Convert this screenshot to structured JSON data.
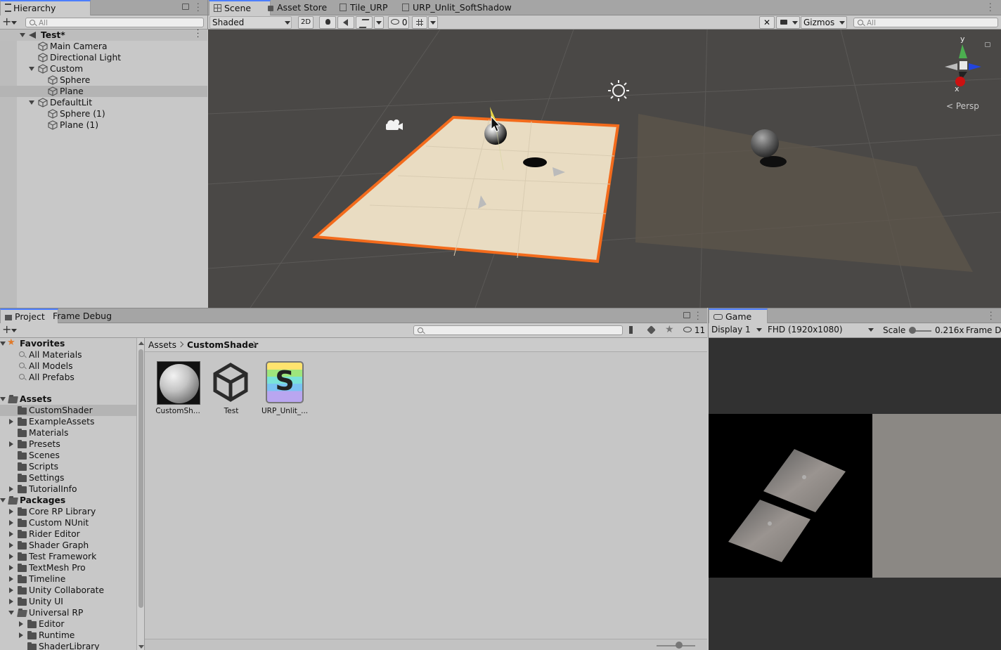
{
  "hierarchy": {
    "tab": "Hierarchy",
    "search_placeholder": "All",
    "scene_name": "Test*",
    "items": [
      {
        "label": "Main Camera"
      },
      {
        "label": "Directional Light"
      },
      {
        "label": "Custom"
      },
      {
        "label": "Sphere"
      },
      {
        "label": "Plane"
      },
      {
        "label": "DefaultLit"
      },
      {
        "label": "Sphere (1)"
      },
      {
        "label": "Plane (1)"
      }
    ]
  },
  "scene_tabs": [
    "Scene",
    "Asset Store",
    "Tile_URP",
    "URP_Unlit_SoftShadow"
  ],
  "scene_toolbar": {
    "shading_mode": "Shaded",
    "mode_2d": "2D",
    "hidden_count": "0",
    "gizmos": "Gizmos",
    "search_placeholder": "All",
    "persp": "Persp",
    "axis_y": "y",
    "axis_x": "x"
  },
  "project": {
    "tabs": [
      "Project",
      "Frame Debug"
    ],
    "hidden_count": "11",
    "favorites_label": "Favorites",
    "favorites": [
      "All Materials",
      "All Models",
      "All Prefabs"
    ],
    "assets_label": "Assets",
    "assets": [
      "CustomShader",
      "ExampleAssets",
      "Materials",
      "Presets",
      "Scenes",
      "Scripts",
      "Settings",
      "TutorialInfo"
    ],
    "packages_label": "Packages",
    "packages": [
      "Core RP Library",
      "Custom NUnit",
      "Rider Editor",
      "Shader Graph",
      "Test Framework",
      "TextMesh Pro",
      "Timeline",
      "Unity Collaborate",
      "Unity UI",
      "Universal RP"
    ],
    "universal_children": [
      "Editor",
      "Runtime",
      "ShaderLibrary"
    ],
    "breadcrumb": [
      "Assets",
      "CustomShader"
    ],
    "files": [
      {
        "label": "CustomSh..."
      },
      {
        "label": "Test"
      },
      {
        "label": "URP_Unlit_..."
      }
    ],
    "shader_letter": "S"
  },
  "game": {
    "tab": "Game",
    "display": "Display 1",
    "resolution": "FHD (1920x1080)",
    "scale_label": "Scale",
    "scale_value": "0.216x",
    "frame_label": "Frame De"
  },
  "colors": {
    "accent": "#4c7eff",
    "selection_outline": "#f36b1c",
    "scene_bg": "#4a4846",
    "plane": "#e9dcc2"
  }
}
